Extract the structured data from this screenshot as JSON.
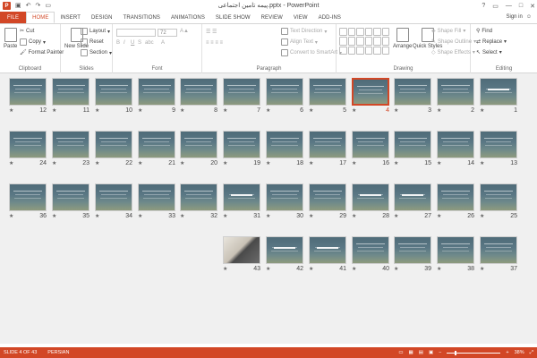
{
  "window": {
    "title": "پیمه تامین اجتماعی.pptx - PowerPoint",
    "qat_icons": [
      "save-icon",
      "undo-icon",
      "redo-icon",
      "slideshow-icon"
    ],
    "controls": [
      "?",
      "▭",
      "—",
      "□",
      "✕"
    ]
  },
  "tabs": [
    "FILE",
    "HOME",
    "INSERT",
    "DESIGN",
    "TRANSITIONS",
    "ANIMATIONS",
    "SLIDE SHOW",
    "REVIEW",
    "VIEW",
    "ADD-INS"
  ],
  "active_tab": "HOME",
  "account": {
    "signin": "Sign in"
  },
  "ribbon": {
    "clipboard": {
      "label": "Clipboard",
      "paste": "Paste",
      "cut": "Cut",
      "copy": "Copy",
      "format_painter": "Format Painter"
    },
    "slides": {
      "label": "Slides",
      "new_slide": "New Slide",
      "layout": "Layout",
      "reset": "Reset",
      "section": "Section"
    },
    "font": {
      "label": "Font",
      "size": "72"
    },
    "paragraph": {
      "label": "Paragraph",
      "text_direction": "Text Direction",
      "align_text": "Align Text",
      "convert_smartart": "Convert to SmartArt"
    },
    "drawing": {
      "label": "Drawing",
      "arrange": "Arrange",
      "quick_styles": "Quick Styles",
      "shape_fill": "Shape Fill",
      "shape_outline": "Shape Outline",
      "shape_effects": "Shape Effects"
    },
    "editing": {
      "label": "Editing",
      "find": "Find",
      "replace": "Replace",
      "select": "Select"
    }
  },
  "slides": [
    {
      "n": "1"
    },
    {
      "n": "2"
    },
    {
      "n": "3"
    },
    {
      "n": "4"
    },
    {
      "n": "5"
    },
    {
      "n": "6"
    },
    {
      "n": "7"
    },
    {
      "n": "8"
    },
    {
      "n": "9"
    },
    {
      "n": "10"
    },
    {
      "n": "11"
    },
    {
      "n": "12"
    },
    {
      "n": "13"
    },
    {
      "n": "14"
    },
    {
      "n": "15"
    },
    {
      "n": "16"
    },
    {
      "n": "17"
    },
    {
      "n": "18"
    },
    {
      "n": "19"
    },
    {
      "n": "20"
    },
    {
      "n": "21"
    },
    {
      "n": "22"
    },
    {
      "n": "23"
    },
    {
      "n": "24"
    },
    {
      "n": "25"
    },
    {
      "n": "26"
    },
    {
      "n": "27"
    },
    {
      "n": "28"
    },
    {
      "n": "29"
    },
    {
      "n": "30"
    },
    {
      "n": "31"
    },
    {
      "n": "32"
    },
    {
      "n": "33"
    },
    {
      "n": "34"
    },
    {
      "n": "35"
    },
    {
      "n": "36"
    },
    {
      "n": "37"
    },
    {
      "n": "38"
    },
    {
      "n": "39"
    },
    {
      "n": "40"
    },
    {
      "n": "41"
    },
    {
      "n": "42"
    },
    {
      "n": "43"
    }
  ],
  "selected_slide": "4",
  "status": {
    "slide_info": "SLIDE 4 OF 43",
    "language": "PERSIAN",
    "zoom": "38%"
  },
  "colors": {
    "accent": "#d24726"
  }
}
